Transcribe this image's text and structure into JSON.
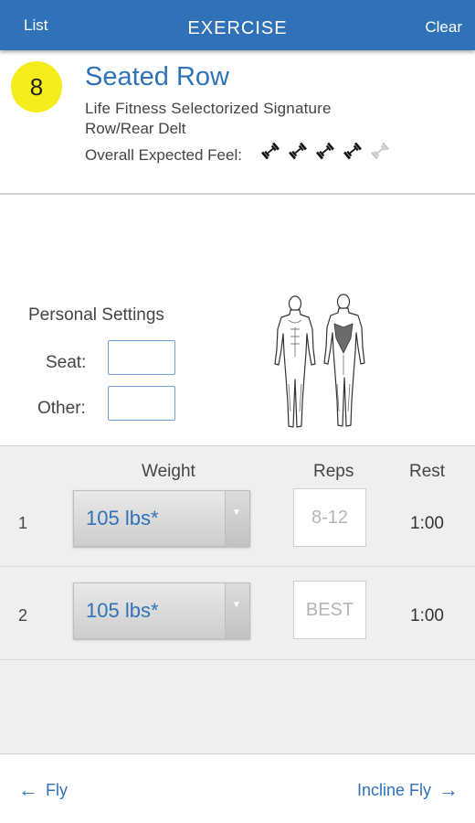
{
  "header": {
    "left_label": "List",
    "title": "EXERCISE",
    "right_label": "Clear"
  },
  "exercise": {
    "number": "8",
    "name": "Seated Row",
    "line1": "Life Fitness  Selectorized Signature",
    "line2": "Row/Rear Delt",
    "feel_label": "Overall Expected Feel:",
    "feel_rating": 4,
    "feel_max": 5
  },
  "settings": {
    "title": "Personal Settings",
    "seat_label": "Seat:",
    "seat_value": "",
    "other_label": "Other:",
    "other_value": ""
  },
  "sets": {
    "headers": {
      "weight": "Weight",
      "reps": "Reps",
      "rest": "Rest"
    },
    "rows": [
      {
        "num": "1",
        "weight": "105 lbs*",
        "reps": "8-12",
        "rest": "1:00"
      },
      {
        "num": "2",
        "weight": "105 lbs*",
        "reps": "BEST",
        "rest": "1:00"
      }
    ]
  },
  "nav": {
    "prev": "Fly",
    "next": "Incline Fly"
  },
  "colors": {
    "brand_blue": "#2f72b8",
    "badge_yellow": "#f5ec1b",
    "muscle_highlight": "#6b6b6b"
  }
}
